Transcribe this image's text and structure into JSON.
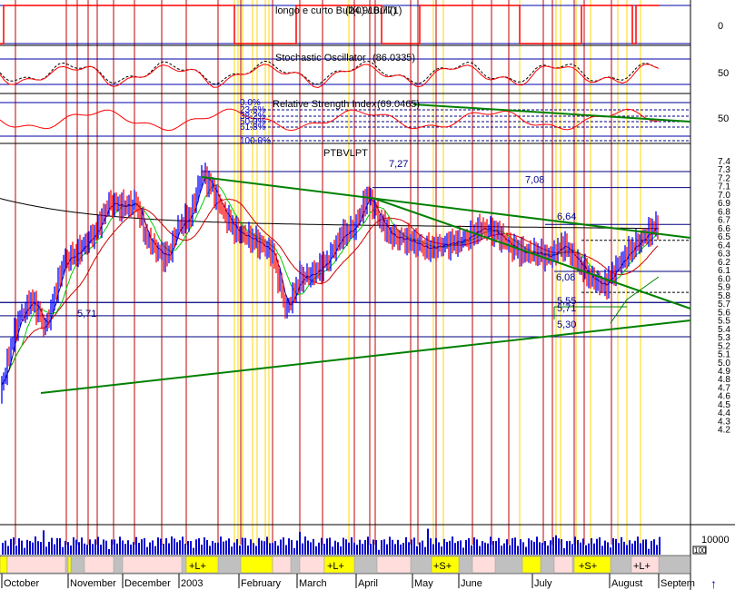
{
  "chart_data": {
    "type": "line",
    "panels": {
      "trend": {
        "label": "longo e curto Bull(0) / Bull(1)",
        "value_text": "(24.910.77)",
        "right_ticks": [
          "0"
        ]
      },
      "stochastic": {
        "label": "Stochastic Oscillator",
        "value_text": "(86.0335)",
        "right_ticks": [
          "50"
        ]
      },
      "rsi": {
        "label": "Relative Strength Index",
        "value_text": "(69.0465)",
        "right_ticks": [
          "50"
        ],
        "fib_labels": [
          "0.0%",
          "23.6%",
          "38.2%",
          "50.0%",
          "61.8%",
          "100.0%"
        ]
      },
      "price": {
        "title": "PTBVLPT",
        "yticks": [
          "7.4",
          "7.3",
          "7.2",
          "7.1",
          "7.0",
          "6.9",
          "6.8",
          "6.7",
          "6.6",
          "6.5",
          "6.4",
          "6.3",
          "6.2",
          "6.1",
          "6.0",
          "5.9",
          "5.8",
          "5.7",
          "5.6",
          "5.5",
          "5.4",
          "5.3",
          "5.2",
          "5.1",
          "5.0",
          "4.9",
          "4.8",
          "4.7",
          "4.6",
          "4.5",
          "4.4",
          "4.3",
          "4.2"
        ],
        "levels": [
          {
            "label": "7,27",
            "value": 7.27
          },
          {
            "label": "7,08",
            "value": 7.08
          },
          {
            "label": "6,64",
            "value": 6.64
          },
          {
            "label": "6,08",
            "value": 6.08
          },
          {
            "label": "5,71",
            "value": 5.71
          },
          {
            "label": "5,71",
            "value": 5.71
          },
          {
            "label": "5,55",
            "value": 5.55
          },
          {
            "label": "5,30",
            "value": 5.3
          }
        ],
        "ylim": [
          4.15,
          7.45
        ]
      },
      "volume": {
        "ytick": "10000",
        "unit_label": "100"
      }
    },
    "x_labels": [
      "October",
      "November",
      "December",
      "2003",
      "February",
      "March",
      "April",
      "May",
      "June",
      "July",
      "August",
      "Septem"
    ],
    "signals": [
      "+L+",
      "+L+",
      "+S+",
      "+S+",
      "+L+"
    ],
    "colors": {
      "price_up": "#0000ff",
      "price_down": "#ff0000",
      "trendline": "#008000",
      "ma_long": "#000000",
      "vertical_sell": "#c00000",
      "vertical_buy": "#ffd700",
      "grid_level": "#000080"
    },
    "scroll_icon": "up-arrow-icon"
  }
}
